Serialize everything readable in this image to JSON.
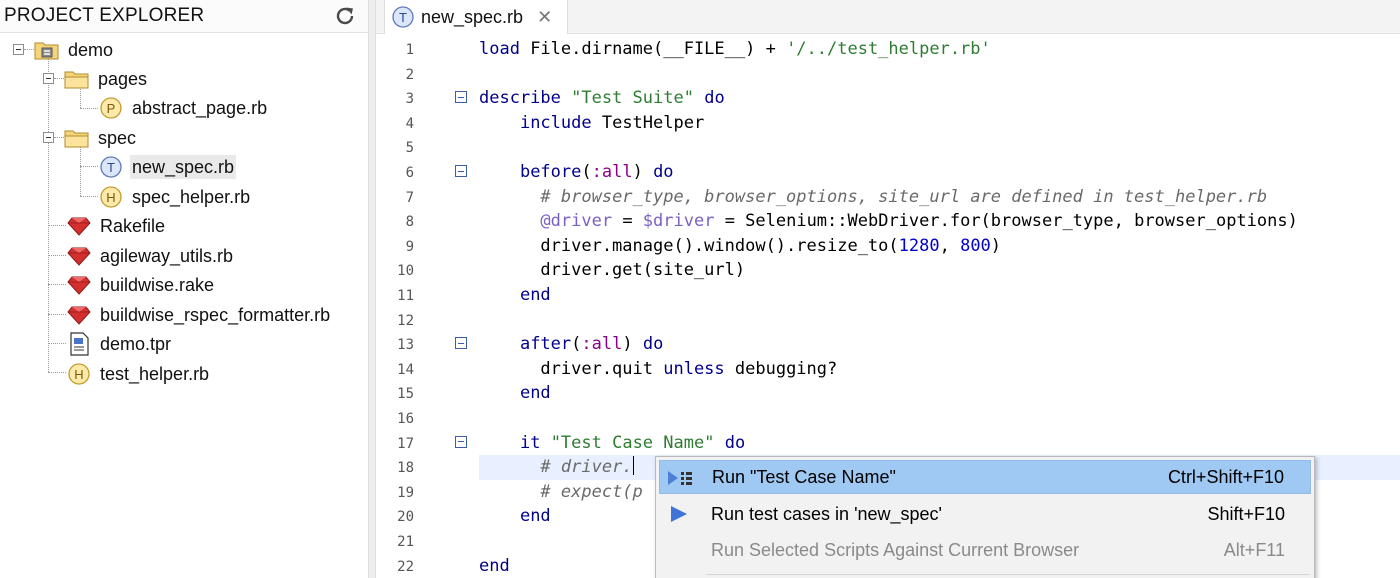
{
  "explorer": {
    "title": "PROJECT EXPLORER",
    "refresh_icon": "refresh-icon",
    "tree": [
      {
        "label": "demo",
        "icon": "project-folder-icon",
        "depth": 0,
        "expanded": true
      },
      {
        "label": "pages",
        "icon": "folder-icon",
        "depth": 1,
        "expanded": true
      },
      {
        "label": "abstract_page.rb",
        "icon": "page-class-icon",
        "badge": "P",
        "depth": 2
      },
      {
        "label": "spec",
        "icon": "folder-icon",
        "depth": 1,
        "expanded": true
      },
      {
        "label": "new_spec.rb",
        "icon": "test-file-icon",
        "badge": "T",
        "depth": 2,
        "selected": true
      },
      {
        "label": "spec_helper.rb",
        "icon": "helper-file-icon",
        "badge": "H",
        "depth": 2
      },
      {
        "label": "Rakefile",
        "icon": "ruby-gem-icon",
        "depth": 1
      },
      {
        "label": "agileway_utils.rb",
        "icon": "ruby-gem-icon",
        "depth": 1
      },
      {
        "label": "buildwise.rake",
        "icon": "ruby-gem-icon",
        "depth": 1
      },
      {
        "label": "buildwise_rspec_formatter.rb",
        "icon": "ruby-gem-icon",
        "depth": 1
      },
      {
        "label": "demo.tpr",
        "icon": "project-file-icon",
        "depth": 1
      },
      {
        "label": "test_helper.rb",
        "icon": "helper-file-icon",
        "badge": "H",
        "depth": 1
      }
    ]
  },
  "editor": {
    "tab": {
      "label": "new_spec.rb",
      "badge": "T",
      "close": "✕"
    },
    "lines": [
      {
        "n": "1",
        "fold": false,
        "text": "load File.dirname(__FILE__) + '/../test_helper.rb'"
      },
      {
        "n": "2",
        "fold": false,
        "text": ""
      },
      {
        "n": "3",
        "fold": true,
        "text": "describe \"Test Suite\" do"
      },
      {
        "n": "4",
        "fold": false,
        "text": "    include TestHelper"
      },
      {
        "n": "5",
        "fold": false,
        "text": ""
      },
      {
        "n": "6",
        "fold": true,
        "text": "    before(:all) do"
      },
      {
        "n": "7",
        "fold": false,
        "text": "      # browser_type, browser_options, site_url are defined in test_helper.rb"
      },
      {
        "n": "8",
        "fold": false,
        "text": "      @driver = $driver = Selenium::WebDriver.for(browser_type, browser_options)"
      },
      {
        "n": "9",
        "fold": false,
        "text": "      driver.manage().window().resize_to(1280, 800)"
      },
      {
        "n": "10",
        "fold": false,
        "text": "      driver.get(site_url)"
      },
      {
        "n": "11",
        "fold": false,
        "text": "    end"
      },
      {
        "n": "12",
        "fold": false,
        "text": ""
      },
      {
        "n": "13",
        "fold": true,
        "text": "    after(:all) do"
      },
      {
        "n": "14",
        "fold": false,
        "text": "      driver.quit unless debugging?"
      },
      {
        "n": "15",
        "fold": false,
        "text": "    end"
      },
      {
        "n": "16",
        "fold": false,
        "text": ""
      },
      {
        "n": "17",
        "fold": true,
        "text": "    it \"Test Case Name\" do"
      },
      {
        "n": "18",
        "fold": false,
        "text": "      # driver."
      },
      {
        "n": "19",
        "fold": false,
        "text": "      # expect(p"
      },
      {
        "n": "20",
        "fold": false,
        "text": "    end"
      },
      {
        "n": "21",
        "fold": false,
        "text": ""
      },
      {
        "n": "22",
        "fold": false,
        "text": "end"
      }
    ]
  },
  "context_menu": {
    "items": [
      {
        "label": "Run \"Test Case Name\"",
        "shortcut": "Ctrl+Shift+F10",
        "icon": "run-test-case-icon",
        "highlighted": true,
        "enabled": true
      },
      {
        "label": "Run test cases in 'new_spec'",
        "shortcut": "Shift+F10",
        "icon": "run-icon",
        "highlighted": false,
        "enabled": true
      },
      {
        "label": "Run Selected Scripts Against Current Browser",
        "shortcut": "Alt+F11",
        "icon": "",
        "highlighted": false,
        "enabled": false
      }
    ]
  },
  "colors": {
    "menu_highlight": "#9fc8f2",
    "keyword": "#00008b",
    "string": "#2e7d32",
    "comment": "#6a6a6a",
    "symbol": "#8b008b",
    "number": "#0000cd",
    "ruby_red": "#d32f2f"
  }
}
